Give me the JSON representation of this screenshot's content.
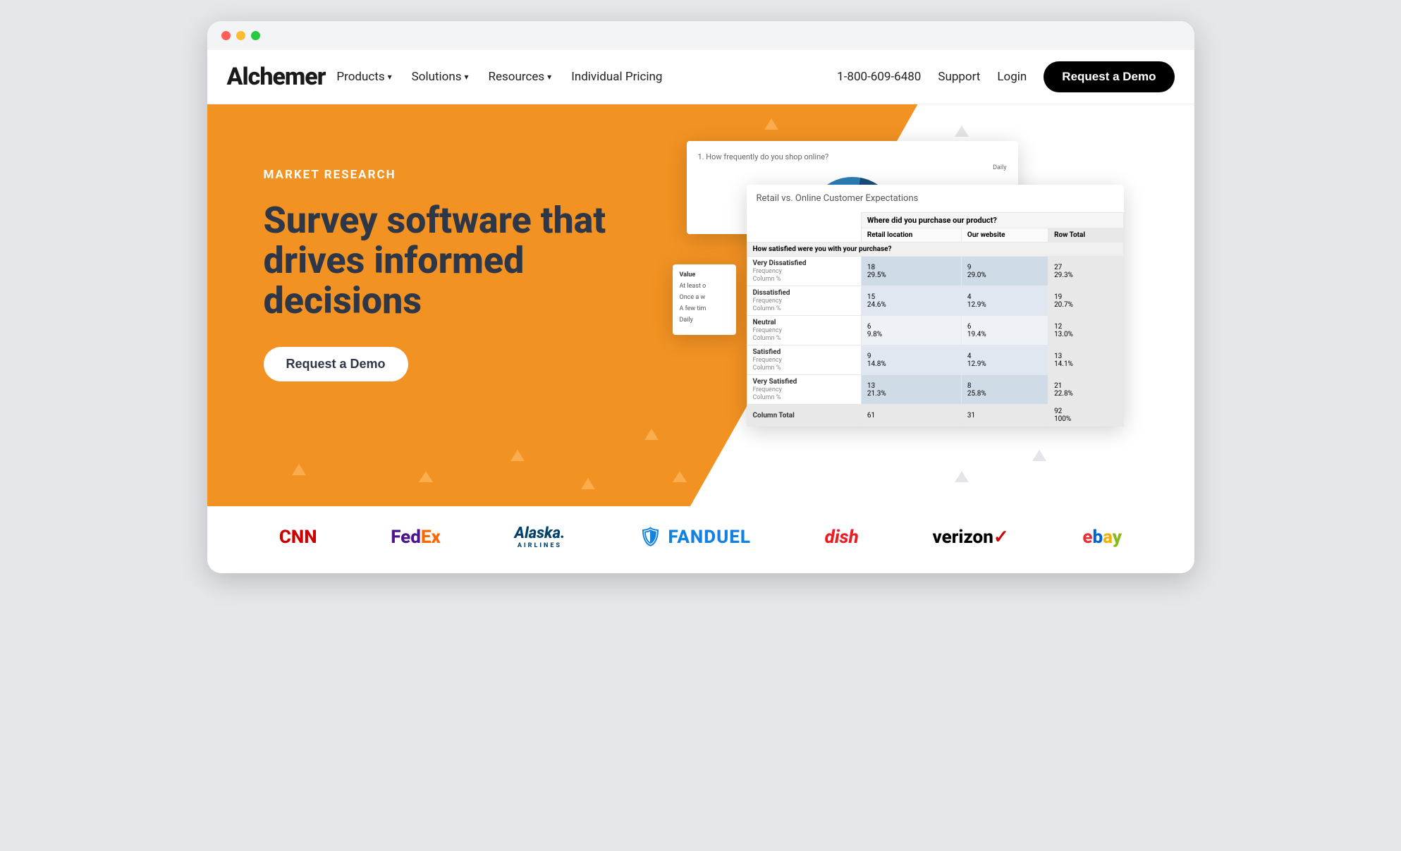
{
  "header": {
    "logo": "Alchemer",
    "nav": {
      "products": "Products",
      "solutions": "Solutions",
      "resources": "Resources",
      "pricing": "Individual Pricing"
    },
    "phone": "1-800-609-6480",
    "support": "Support",
    "login": "Login",
    "cta": "Request a Demo"
  },
  "hero": {
    "eyebrow": "MARKET RESEARCH",
    "headline": "Survey software that drives informed decisions",
    "cta": "Request a Demo"
  },
  "pie_panel": {
    "question": "1. How frequently do you shop online?",
    "label": "Daily"
  },
  "values_panel": {
    "header": "Value",
    "rows": [
      "At least o",
      "Once a w",
      "A few tim",
      "Daily"
    ]
  },
  "crosstab": {
    "title": "Retail vs. Online Customer Expectations",
    "top_q": "Where did you purchase our product?",
    "cols": [
      "Retail location",
      "Our website",
      "Row Total"
    ],
    "left_q": "How satisfied were you with your purchase?",
    "sub_freq": "Frequency",
    "sub_col": "Column %",
    "rows": [
      {
        "label": "Very Dissatisfied",
        "c1": "18",
        "c1p": "29.5%",
        "c2": "9",
        "c2p": "29.0%",
        "t": "27",
        "tp": "29.3%"
      },
      {
        "label": "Dissatisfied",
        "c1": "15",
        "c1p": "24.6%",
        "c2": "4",
        "c2p": "12.9%",
        "t": "19",
        "tp": "20.7%"
      },
      {
        "label": "Neutral",
        "c1": "6",
        "c1p": "9.8%",
        "c2": "6",
        "c2p": "19.4%",
        "t": "12",
        "tp": "13.0%"
      },
      {
        "label": "Satisfied",
        "c1": "9",
        "c1p": "14.8%",
        "c2": "4",
        "c2p": "12.9%",
        "t": "13",
        "tp": "14.1%"
      },
      {
        "label": "Very Satisfied",
        "c1": "13",
        "c1p": "21.3%",
        "c2": "8",
        "c2p": "25.8%",
        "t": "21",
        "tp": "22.8%"
      }
    ],
    "total": {
      "label": "Column Total",
      "c1": "61",
      "c2": "31",
      "t": "92",
      "tp": "100%"
    }
  },
  "brands": {
    "cnn": "CNN",
    "alaska_top": "Alaska.",
    "alaska_sub": "AIRLINES",
    "fanduel": "FANDUEL",
    "dish": "dish",
    "verizon": "verizon"
  }
}
